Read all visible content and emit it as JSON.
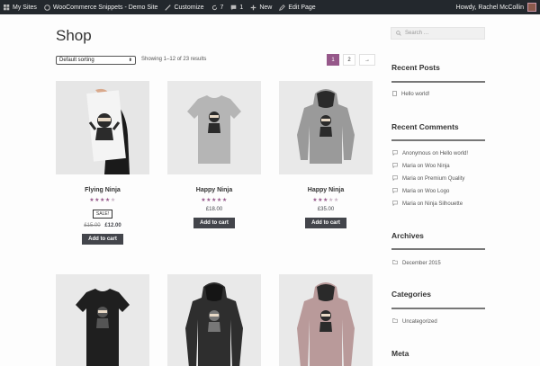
{
  "admin_bar": {
    "my_sites": "My Sites",
    "site_name": "WooCommerce Snippets - Demo Site",
    "customize": "Customize",
    "updates": "7",
    "comments": "1",
    "new": "New",
    "edit_page": "Edit Page",
    "greeting": "Howdy, Rachel McCollin"
  },
  "page_title": "Shop",
  "toolbar": {
    "sort_value": "Default sorting",
    "result_count": "Showing 1–12 of 23 results",
    "pages": [
      "1",
      "2",
      "→"
    ]
  },
  "products": [
    {
      "name": "Flying Ninja",
      "rating": 4,
      "sale_badge": "SALE!",
      "old_price": "£15.00",
      "price": "£12.00",
      "button": "Add to cart"
    },
    {
      "name": "Happy Ninja",
      "rating": 5,
      "price": "£18.00",
      "button": "Add to cart"
    },
    {
      "name": "Happy Ninja",
      "rating": 3,
      "price": "£35.00",
      "button": "Add to cart"
    },
    {
      "name": "",
      "rating": 0,
      "price": "",
      "button": ""
    },
    {
      "name": "",
      "rating": 0,
      "price": "",
      "button": ""
    },
    {
      "name": "",
      "rating": 0,
      "price": "",
      "button": ""
    }
  ],
  "sidebar": {
    "search_placeholder": "Search …",
    "recent_posts_title": "Recent Posts",
    "recent_posts": [
      "Hello world!"
    ],
    "recent_comments_title": "Recent Comments",
    "recent_comments": [
      {
        "author": "Anonymous",
        "sep": " on ",
        "post": "Hello world!"
      },
      {
        "author": "Maria",
        "sep": " on ",
        "post": "Woo Ninja"
      },
      {
        "author": "Maria",
        "sep": " on ",
        "post": "Premium Quality"
      },
      {
        "author": "Maria",
        "sep": " on ",
        "post": "Woo Logo"
      },
      {
        "author": "Maria",
        "sep": " on ",
        "post": "Ninja Silhouette"
      }
    ],
    "archives_title": "Archives",
    "archives": [
      "December 2015"
    ],
    "categories_title": "Categories",
    "categories": [
      "Uncategorized"
    ],
    "meta_title": "Meta"
  },
  "colors": {
    "accent": "#96588a",
    "admin_bar": "#23282d",
    "button": "#43454b"
  }
}
